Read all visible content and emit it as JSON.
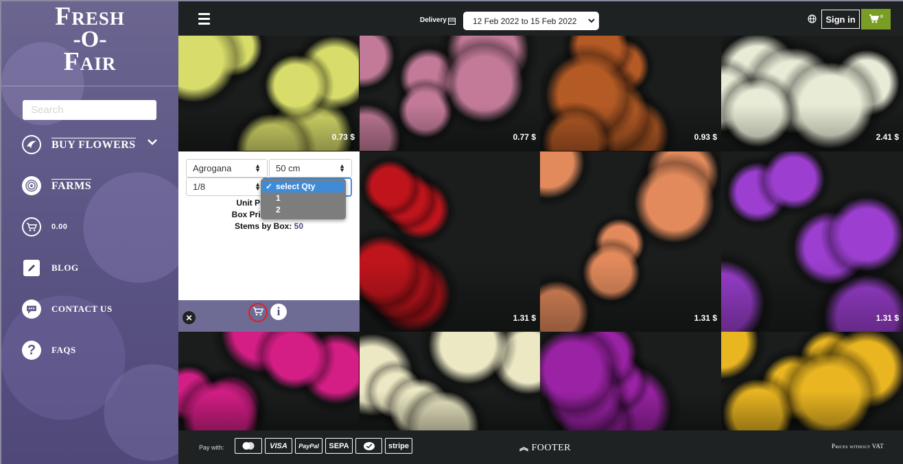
{
  "brand": {
    "line1": "Fresh",
    "line2": "-O-",
    "line3": "Fair"
  },
  "search": {
    "placeholder": "Search"
  },
  "nav": {
    "buy_flowers": "BUY FLOWERS",
    "farms": "FARMS",
    "cart_total": "0.00",
    "blog": "BLOG",
    "contact": "CONTACT US",
    "faqs": "FAQS"
  },
  "header": {
    "delivery_label": "Delivery",
    "delivery_range": "12 Feb 2022 to 15 Feb 2022",
    "signin": "Sign in",
    "cart_count": "0"
  },
  "products": [
    {
      "price": "0.73 $",
      "color": "#d7dc6a"
    },
    {
      "price": "0.77 $",
      "color": "#c27a98"
    },
    {
      "price": "0.93 $",
      "color": "#b45a25"
    },
    {
      "price": "2.41 $",
      "color": "#e8ebd6"
    },
    {
      "price": "1.31 $",
      "color": "#c0141c"
    },
    {
      "price": "1.31 $",
      "color": "#e28a5c"
    },
    {
      "price": "1.31 $",
      "color": "#9c3fd0"
    },
    {
      "price": "",
      "color": "#d41e86"
    },
    {
      "price": "",
      "color": "#ece8c4"
    },
    {
      "price": "",
      "color": "#9a22a4"
    },
    {
      "price": "",
      "color": "#e9b521"
    }
  ],
  "card": {
    "farm": "Agrogana",
    "length": "50 cm",
    "box": "1/8",
    "unit_price_label": "Unit Pr",
    "box_price_label": "Box Pric",
    "stems_label": "Stems by Box:",
    "stems_value": "50"
  },
  "qty_dropdown": {
    "options": [
      "select Qty",
      "1",
      "2"
    ],
    "selected": "select Qty"
  },
  "footer": {
    "pay_with": "Pay with:",
    "methods": [
      "mastercard",
      "VISA",
      "PayPal",
      "SEPA",
      "wechat",
      "stripe"
    ],
    "toggle": "FOOTER",
    "prices_note": "Prices without VAT"
  }
}
